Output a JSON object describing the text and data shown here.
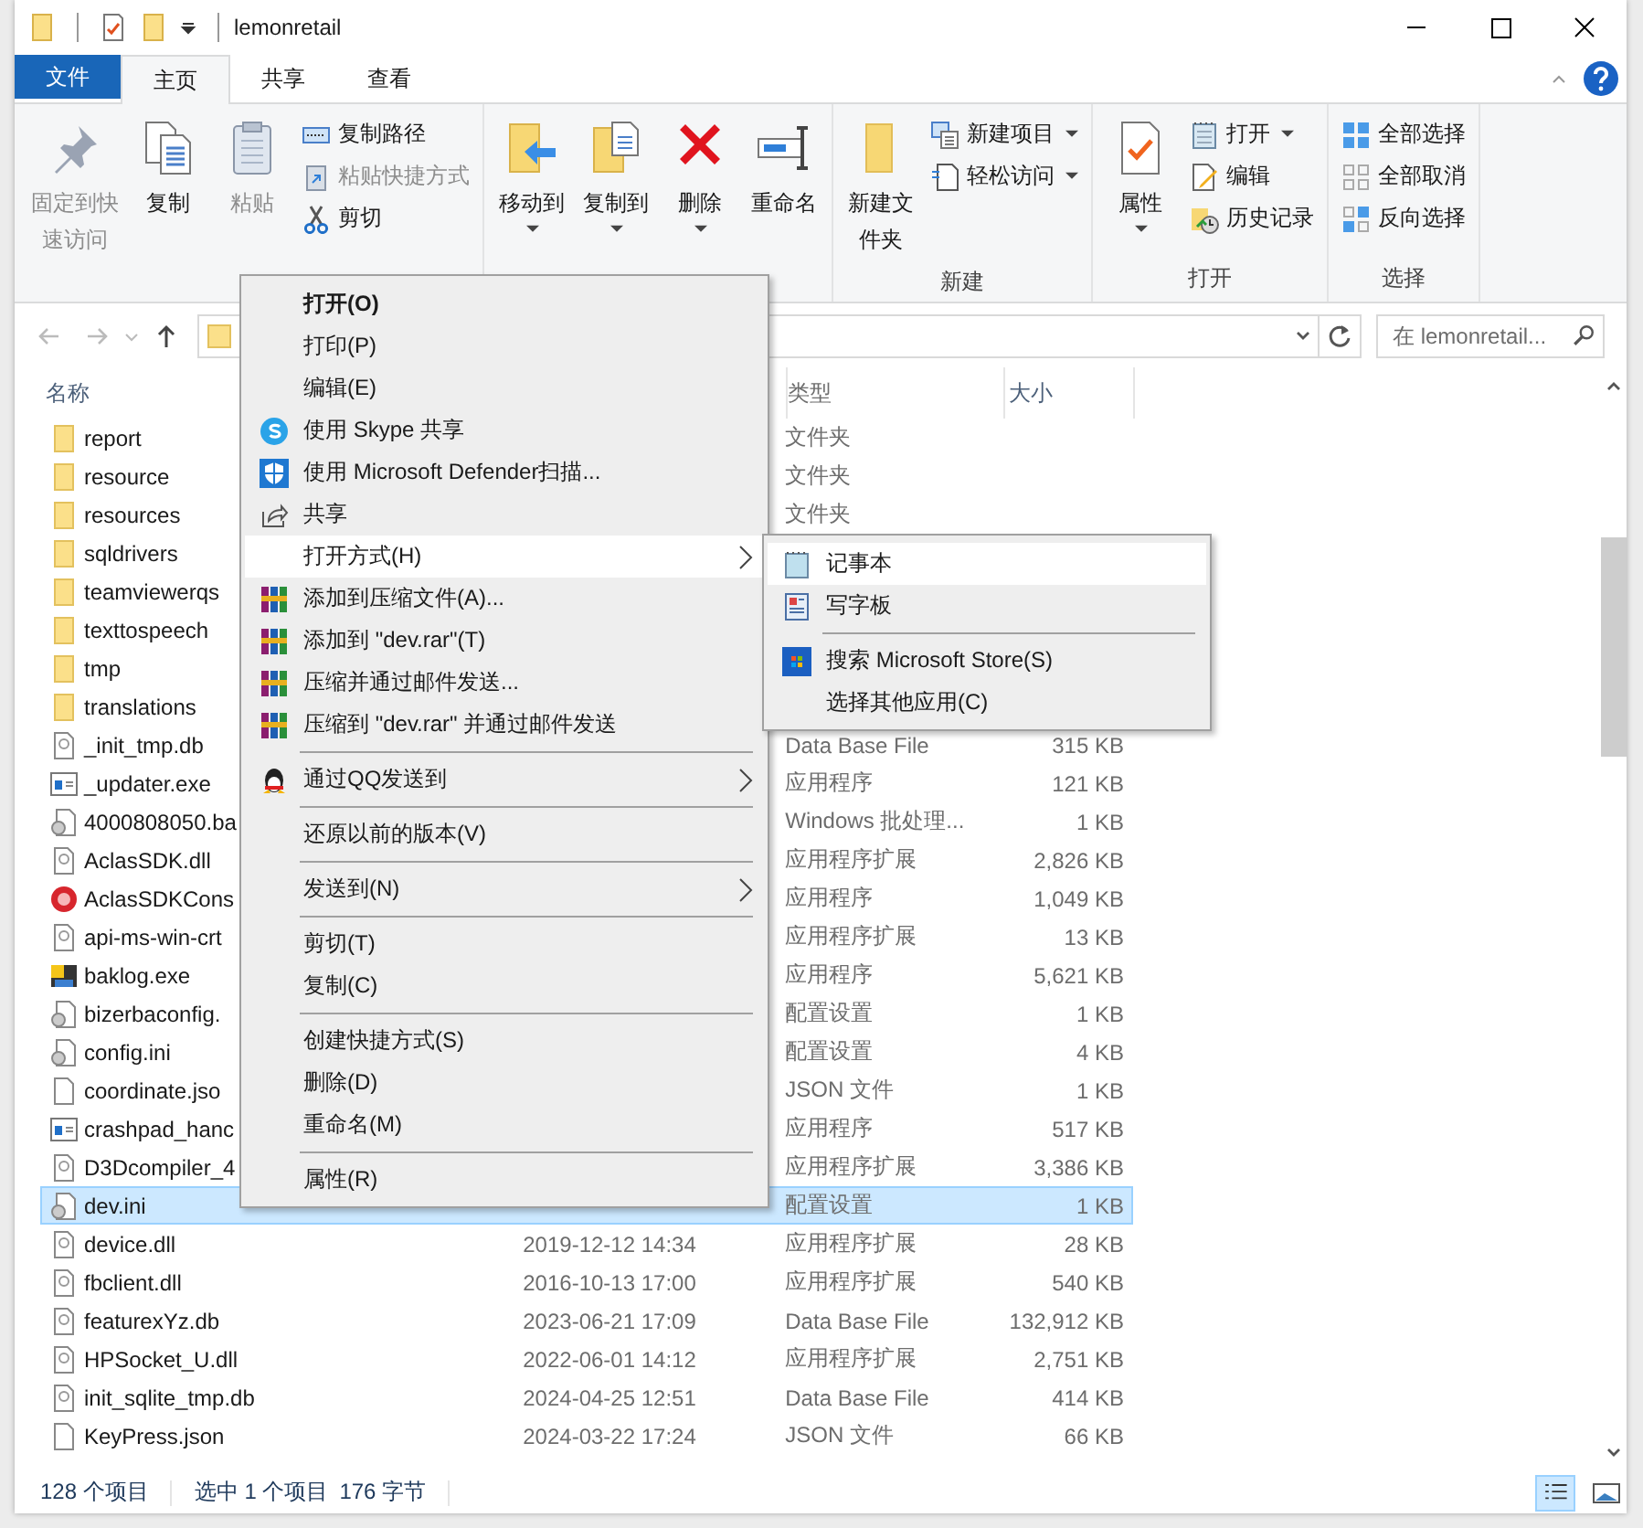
{
  "window": {
    "title": "lemonretail"
  },
  "tabs": [
    {
      "label": "文件",
      "kind": "file",
      "selected": false
    },
    {
      "label": "主页",
      "kind": "tab",
      "selected": true
    },
    {
      "label": "共享",
      "kind": "tab",
      "selected": false
    },
    {
      "label": "查看",
      "kind": "tab",
      "selected": false
    }
  ],
  "ribbon": [
    {
      "items": [
        {
          "kind": "large",
          "label": "固定到快速访问",
          "disabled": true
        },
        {
          "kind": "large",
          "label": "复制",
          "disabled": false
        },
        {
          "kind": "large",
          "label": "粘贴",
          "disabled": true
        },
        {
          "kind": "stack",
          "items": [
            {
              "label": "复制路径",
              "disabled": false
            },
            {
              "label": "粘贴快捷方式",
              "disabled": true
            },
            {
              "label": "剪切",
              "disabled": false
            }
          ]
        }
      ]
    },
    {
      "items": [
        {
          "kind": "large",
          "label": "移动到",
          "dropdown": true
        },
        {
          "kind": "large",
          "label": "复制到",
          "dropdown": true
        },
        {
          "kind": "large",
          "label": "删除",
          "dropdown": true
        },
        {
          "kind": "large",
          "label": "重命名",
          "dropdown": false
        }
      ]
    },
    {
      "label": "新建",
      "items": [
        {
          "kind": "large",
          "label": "新建文件夹",
          "dropdown": false
        },
        {
          "kind": "stack",
          "items": [
            {
              "label": "新建项目",
              "dropdown": true
            },
            {
              "label": "轻松访问",
              "dropdown": true
            }
          ]
        }
      ]
    },
    {
      "label": "打开",
      "items": [
        {
          "kind": "large",
          "label": "属性",
          "dropdown": true
        },
        {
          "kind": "stack",
          "items": [
            {
              "label": "打开",
              "dropdown": true
            },
            {
              "label": "编辑",
              "dropdown": false
            },
            {
              "label": "历史记录",
              "dropdown": false
            }
          ]
        }
      ]
    },
    {
      "label": "选择",
      "items": [
        {
          "kind": "stack",
          "items": [
            {
              "label": "全部选择"
            },
            {
              "label": "全部取消"
            },
            {
              "label": "反向选择"
            }
          ]
        }
      ]
    }
  ],
  "search": {
    "placeholder": "在 lemonretail..."
  },
  "columns": [
    "名称",
    "类型",
    "大小"
  ],
  "files": [
    {
      "name": "report",
      "kind": "folder",
      "type": "文件夹",
      "selected": false
    },
    {
      "name": "resource",
      "kind": "folder",
      "type": "文件夹",
      "selected": false
    },
    {
      "name": "resources",
      "kind": "folder",
      "type": "文件夹",
      "selected": false
    },
    {
      "name": "sqldrivers",
      "kind": "folder",
      "selected": false
    },
    {
      "name": "teamviewerqs",
      "kind": "folder",
      "selected": false
    },
    {
      "name": "texttospeech",
      "kind": "folder",
      "selected": false
    },
    {
      "name": "tmp",
      "kind": "folder",
      "selected": false
    },
    {
      "name": "translations",
      "kind": "folder",
      "selected": false
    },
    {
      "name": "_init_tmp.db",
      "kind": "file",
      "type": "Data Base File",
      "size": "315 KB",
      "selected": false
    },
    {
      "name": "_updater.exe",
      "kind": "window",
      "type": "应用程序",
      "size": "121 KB",
      "selected": false
    },
    {
      "name": "4000808050.ba",
      "kind": "gear",
      "type": "Windows 批处理...",
      "size": "1 KB",
      "selected": false
    },
    {
      "name": "AclasSDK.dll",
      "kind": "file",
      "type": "应用程序扩展",
      "size": "2,826 KB",
      "selected": false
    },
    {
      "name": "AclasSDKCons",
      "kind": "redapp",
      "type": "应用程序",
      "size": "1,049 KB",
      "selected": false
    },
    {
      "name": "api-ms-win-crt",
      "kind": "file",
      "type": "应用程序扩展",
      "size": "13 KB",
      "selected": false
    },
    {
      "name": "baklog.exe",
      "kind": "app",
      "type": "应用程序",
      "size": "5,621 KB",
      "selected": false
    },
    {
      "name": "bizerbaconfig.",
      "kind": "gear",
      "type": "配置设置",
      "size": "1 KB",
      "selected": false
    },
    {
      "name": "config.ini",
      "kind": "gear",
      "type": "配置设置",
      "size": "4 KB",
      "selected": false
    },
    {
      "name": "coordinate.jso",
      "kind": "blank",
      "type": "JSON 文件",
      "size": "1 KB",
      "selected": false
    },
    {
      "name": "crashpad_hanc",
      "kind": "window",
      "type": "应用程序",
      "size": "517 KB",
      "selected": false
    },
    {
      "name": "D3Dcompiler_4",
      "kind": "file",
      "type": "应用程序扩展",
      "size": "3,386 KB",
      "selected": false
    },
    {
      "name": "dev.ini",
      "kind": "gear",
      "type": "配置设置",
      "size": "1 KB",
      "selected": true
    },
    {
      "name": "device.dll",
      "kind": "file",
      "date": "2019-12-12 14:34",
      "type": "应用程序扩展",
      "size": "28 KB",
      "selected": false
    },
    {
      "name": "fbclient.dll",
      "kind": "file",
      "date": "2016-10-13 17:00",
      "type": "应用程序扩展",
      "size": "540 KB",
      "selected": false
    },
    {
      "name": "featurexYz.db",
      "kind": "file",
      "date": "2023-06-21 17:09",
      "type": "Data Base File",
      "size": "132,912 KB",
      "selected": false
    },
    {
      "name": "HPSocket_U.dll",
      "kind": "file",
      "date": "2022-06-01 14:12",
      "type": "应用程序扩展",
      "size": "2,751 KB",
      "selected": false
    },
    {
      "name": "init_sqlite_tmp.db",
      "kind": "file",
      "date": "2024-04-25 12:51",
      "type": "Data Base File",
      "size": "414 KB",
      "selected": false
    },
    {
      "name": "KeyPress.json",
      "kind": "blank",
      "date": "2024-03-22 17:24",
      "type": "JSON 文件",
      "size": "66 KB",
      "selected": false
    }
  ],
  "status_bar": {
    "count": "128 个项目",
    "selection": "选中 1 个项目",
    "size": "176 字节"
  },
  "context_menu": [
    {
      "kind": "item",
      "label": "打开(O)",
      "bold": true,
      "selected": false
    },
    {
      "kind": "item",
      "label": "打印(P)",
      "bold": false,
      "selected": false
    },
    {
      "kind": "item",
      "label": "编辑(E)",
      "bold": false,
      "selected": false
    },
    {
      "kind": "item",
      "label": "使用 Skype 共享",
      "bold": false,
      "selected": false
    },
    {
      "kind": "item",
      "label": "使用 Microsoft Defender扫描...",
      "bold": false,
      "selected": false
    },
    {
      "kind": "item",
      "label": "共享",
      "bold": false,
      "selected": false
    },
    {
      "kind": "item",
      "label": "打开方式(H)",
      "bold": false,
      "submenu": true,
      "selected": true
    },
    {
      "kind": "item",
      "label": "添加到压缩文件(A)...",
      "bold": false,
      "selected": false
    },
    {
      "kind": "item",
      "label": "添加到 \"dev.rar\"(T)",
      "bold": false,
      "selected": false
    },
    {
      "kind": "item",
      "label": "压缩并通过邮件发送...",
      "bold": false,
      "selected": false
    },
    {
      "kind": "item",
      "label": "压缩到 \"dev.rar\" 并通过邮件发送",
      "bold": false,
      "selected": false
    },
    {
      "kind": "separator"
    },
    {
      "kind": "item",
      "label": "通过QQ发送到",
      "bold": false,
      "submenu": true,
      "selected": false
    },
    {
      "kind": "separator"
    },
    {
      "kind": "item",
      "label": "还原以前的版本(V)",
      "bold": false,
      "selected": false
    },
    {
      "kind": "separator"
    },
    {
      "kind": "item",
      "label": "发送到(N)",
      "bold": false,
      "submenu": true,
      "selected": false
    },
    {
      "kind": "separator"
    },
    {
      "kind": "item",
      "label": "剪切(T)",
      "bold": false,
      "selected": false
    },
    {
      "kind": "item",
      "label": "复制(C)",
      "bold": false,
      "selected": false
    },
    {
      "kind": "separator"
    },
    {
      "kind": "item",
      "label": "创建快捷方式(S)",
      "bold": false,
      "selected": false
    },
    {
      "kind": "item",
      "label": "删除(D)",
      "bold": false,
      "selected": false
    },
    {
      "kind": "item",
      "label": "重命名(M)",
      "bold": false,
      "selected": false
    },
    {
      "kind": "separator"
    },
    {
      "kind": "item",
      "label": "属性(R)",
      "bold": false,
      "selected": false
    }
  ],
  "submenu": [
    {
      "kind": "item",
      "label": "记事本",
      "selected": true
    },
    {
      "kind": "item",
      "label": "写字板",
      "selected": false
    },
    {
      "kind": "separator"
    },
    {
      "kind": "item",
      "label": "搜索 Microsoft Store(S)",
      "selected": false
    },
    {
      "kind": "item",
      "label": "选择其他应用(C)",
      "selected": false
    }
  ]
}
